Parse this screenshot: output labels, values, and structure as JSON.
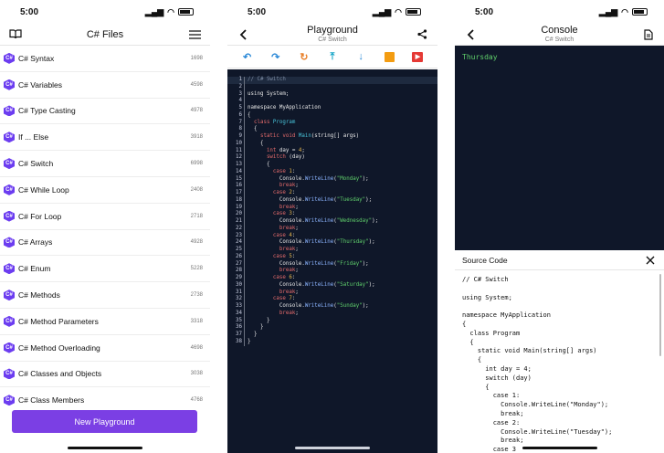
{
  "status": {
    "time": "5:00"
  },
  "files": {
    "title": "C# Files",
    "items": [
      {
        "name": "C# Syntax",
        "size": "1698"
      },
      {
        "name": "C# Variables",
        "size": "4598"
      },
      {
        "name": "C# Type Casting",
        "size": "4978"
      },
      {
        "name": "If ... Else",
        "size": "3918"
      },
      {
        "name": "C# Switch",
        "size": "6998"
      },
      {
        "name": "C# While Loop",
        "size": "2408"
      },
      {
        "name": "C# For Loop",
        "size": "2718"
      },
      {
        "name": "C# Arrays",
        "size": "4928"
      },
      {
        "name": "C# Enum",
        "size": "5228"
      },
      {
        "name": "C# Methods",
        "size": "2738"
      },
      {
        "name": "C# Method Parameters",
        "size": "3318"
      },
      {
        "name": "C# Method Overloading",
        "size": "4698"
      },
      {
        "name": "C# Classes and Objects",
        "size": "3038"
      },
      {
        "name": "C# Class Members",
        "size": "4768"
      }
    ],
    "new_button": "New Playground"
  },
  "playground": {
    "title": "Playground",
    "subtitle": "C# Switch",
    "code": [
      [
        [
          "cm",
          "// C# Switch"
        ]
      ],
      [],
      [
        [
          "",
          "using System;"
        ]
      ],
      [],
      [
        [
          "",
          "namespace MyApplication"
        ]
      ],
      [
        [
          "",
          "{"
        ]
      ],
      [
        [
          "kw",
          "  class "
        ],
        [
          "ty",
          "Program"
        ]
      ],
      [
        [
          "",
          "  {"
        ]
      ],
      [
        [
          "kw",
          "    static void "
        ],
        [
          "ty",
          "Main"
        ],
        [
          "",
          "(string[] args)"
        ]
      ],
      [
        [
          "",
          "    {"
        ]
      ],
      [
        [
          "kw",
          "      int "
        ],
        [
          "",
          "day = "
        ],
        [
          "nm",
          "4"
        ],
        [
          "",
          ";"
        ]
      ],
      [
        [
          "kw",
          "      switch "
        ],
        [
          "",
          "(day)"
        ]
      ],
      [
        [
          "",
          "      {"
        ]
      ],
      [
        [
          "kw",
          "        case "
        ],
        [
          "nm",
          "1"
        ],
        [
          "",
          ":"
        ]
      ],
      [
        [
          "",
          "          Console."
        ],
        [
          "fn",
          "WriteLine"
        ],
        [
          "",
          "("
        ],
        [
          "st",
          "\"Monday\""
        ],
        [
          "",
          ");"
        ]
      ],
      [
        [
          "kw",
          "          break"
        ],
        [
          "",
          ";"
        ]
      ],
      [
        [
          "kw",
          "        case "
        ],
        [
          "nm",
          "2"
        ],
        [
          "",
          ":"
        ]
      ],
      [
        [
          "",
          "          Console."
        ],
        [
          "fn",
          "WriteLine"
        ],
        [
          "",
          "("
        ],
        [
          "st",
          "\"Tuesday\""
        ],
        [
          "",
          ");"
        ]
      ],
      [
        [
          "kw",
          "          break"
        ],
        [
          "",
          ";"
        ]
      ],
      [
        [
          "kw",
          "        case "
        ],
        [
          "nm",
          "3"
        ],
        [
          "",
          ":"
        ]
      ],
      [
        [
          "",
          "          Console."
        ],
        [
          "fn",
          "WriteLine"
        ],
        [
          "",
          "("
        ],
        [
          "st",
          "\"Wednesday\""
        ],
        [
          "",
          ");"
        ]
      ],
      [
        [
          "kw",
          "          break"
        ],
        [
          "",
          ";"
        ]
      ],
      [
        [
          "kw",
          "        case "
        ],
        [
          "nm",
          "4"
        ],
        [
          "",
          ":"
        ]
      ],
      [
        [
          "",
          "          Console."
        ],
        [
          "fn",
          "WriteLine"
        ],
        [
          "",
          "("
        ],
        [
          "st",
          "\"Thursday\""
        ],
        [
          "",
          ");"
        ]
      ],
      [
        [
          "kw",
          "          break"
        ],
        [
          "",
          ";"
        ]
      ],
      [
        [
          "kw",
          "        case "
        ],
        [
          "nm",
          "5"
        ],
        [
          "",
          ":"
        ]
      ],
      [
        [
          "",
          "          Console."
        ],
        [
          "fn",
          "WriteLine"
        ],
        [
          "",
          "("
        ],
        [
          "st",
          "\"Friday\""
        ],
        [
          "",
          ");"
        ]
      ],
      [
        [
          "kw",
          "          break"
        ],
        [
          "",
          ";"
        ]
      ],
      [
        [
          "kw",
          "        case "
        ],
        [
          "nm",
          "6"
        ],
        [
          "",
          ":"
        ]
      ],
      [
        [
          "",
          "          Console."
        ],
        [
          "fn",
          "WriteLine"
        ],
        [
          "",
          "("
        ],
        [
          "st",
          "\"Saturday\""
        ],
        [
          "",
          ");"
        ]
      ],
      [
        [
          "kw",
          "          break"
        ],
        [
          "",
          ";"
        ]
      ],
      [
        [
          "kw",
          "        case "
        ],
        [
          "nm",
          "7"
        ],
        [
          "",
          ":"
        ]
      ],
      [
        [
          "",
          "          Console."
        ],
        [
          "fn",
          "WriteLine"
        ],
        [
          "",
          "("
        ],
        [
          "st",
          "\"Sunday\""
        ],
        [
          "",
          ");"
        ]
      ],
      [
        [
          "kw",
          "          break"
        ],
        [
          "",
          ";"
        ]
      ],
      [
        [
          "",
          "      }"
        ]
      ],
      [
        [
          "",
          "    }"
        ]
      ],
      [
        [
          "",
          "  }"
        ]
      ],
      [
        [
          "",
          "}"
        ]
      ]
    ]
  },
  "console": {
    "title": "Console",
    "subtitle": "C# Switch",
    "output": "Thursday",
    "source_title": "Source Code",
    "source": "// C# Switch\n\nusing System;\n\nnamespace MyApplication\n{\n  class Program\n  {\n    static void Main(string[] args)\n    {\n      int day = 4;\n      switch (day)\n      {\n        case 1:\n          Console.WriteLine(\"Monday\");\n          break;\n        case 2:\n          Console.WriteLine(\"Tuesday\");\n          break;\n        case 3"
  },
  "colors": {
    "accent": "#7b3fe4",
    "editor_bg": "#0f1729",
    "output_text": "#5fcf6b"
  },
  "icons": [
    "book-icon",
    "menu-icon",
    "back-icon",
    "share-icon",
    "undo-icon",
    "redo-icon",
    "refresh-icon",
    "upload-icon",
    "download-icon",
    "save-icon",
    "run-icon",
    "document-icon",
    "close-icon",
    "csharp-icon"
  ]
}
